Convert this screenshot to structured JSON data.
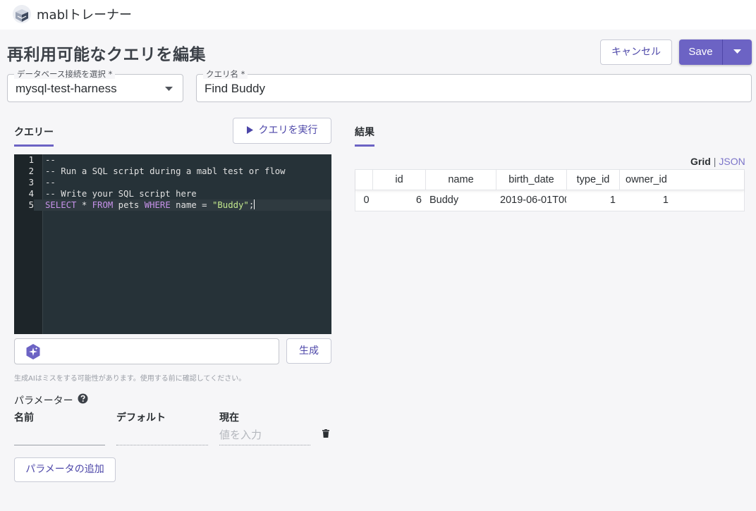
{
  "app": {
    "title": "mablトレーナー"
  },
  "page": {
    "title": "再利用可能なクエリを編集"
  },
  "actions": {
    "cancel_label": "キャンセル",
    "save_label": "Save"
  },
  "db_select": {
    "label": "データベース接続を選択 *",
    "value": "mysql-test-harness"
  },
  "query_name": {
    "label": "クエリ名 *",
    "value": "Find Buddy"
  },
  "query_panel": {
    "tab_label": "クエリー",
    "run_label": "クエリを実行",
    "code_lines": [
      {
        "num": "1",
        "text": "--"
      },
      {
        "num": "2",
        "text": "-- Run a SQL script during a mabl test or flow"
      },
      {
        "num": "3",
        "text": "--"
      },
      {
        "num": "4",
        "text": "-- Write your SQL script here"
      },
      {
        "num": "5",
        "text": "SELECT * FROM pets WHERE name = \"Buddy\";"
      }
    ],
    "generate_label": "生成",
    "ai_input_value": "",
    "disclaimer": "生成AIはミスをする可能性があります。使用する前に確認してください。"
  },
  "parameters": {
    "title": "パラメーター",
    "columns": {
      "name": "名前",
      "default": "デフォルト",
      "current": "現在"
    },
    "current_placeholder": "値を入力",
    "add_label": "パラメータの追加"
  },
  "results": {
    "tab_label": "結果",
    "view_grid": "Grid",
    "view_sep": "|",
    "view_json": "JSON",
    "columns": [
      "",
      "id",
      "name",
      "birth_date",
      "type_id",
      "owner_id"
    ],
    "rows": [
      [
        "0",
        "6",
        "Buddy",
        "2019-06-01T00",
        "1",
        "1"
      ]
    ]
  },
  "colors": {
    "accent": "#6c63c4",
    "editor_bg": "#263238",
    "keyword": "#c792ea",
    "string": "#c3e88d",
    "comment": "#6c7a82"
  },
  "icons": [
    "mabl-logo-icon",
    "chevron-down-icon",
    "play-icon",
    "ai-sparkle-icon",
    "help-icon",
    "trash-icon"
  ]
}
